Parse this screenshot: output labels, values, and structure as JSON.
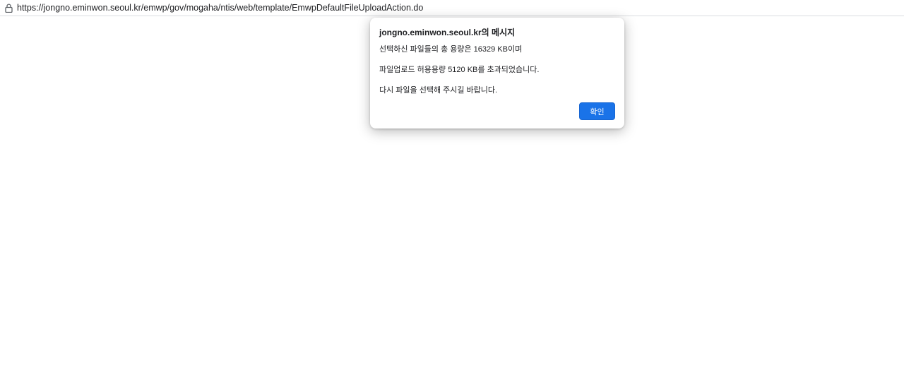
{
  "address_bar": {
    "url": "https://jongno.eminwon.seoul.kr/emwp/gov/mogaha/ntis/web/template/EmwpDefaultFileUploadAction.do",
    "security_icon": "lock-icon"
  },
  "dialog": {
    "title": "jongno.eminwon.seoul.kr의 메시지",
    "lines": [
      "선택하신 파일들의 총 용량은 16329 KB이며",
      "파일업로드 허용용량 5120 KB를 초과되었습니다.",
      "다시 파일을 선택해 주시길 바랍니다."
    ],
    "ok_label": "확인",
    "accent_color": "#1a73e8"
  }
}
